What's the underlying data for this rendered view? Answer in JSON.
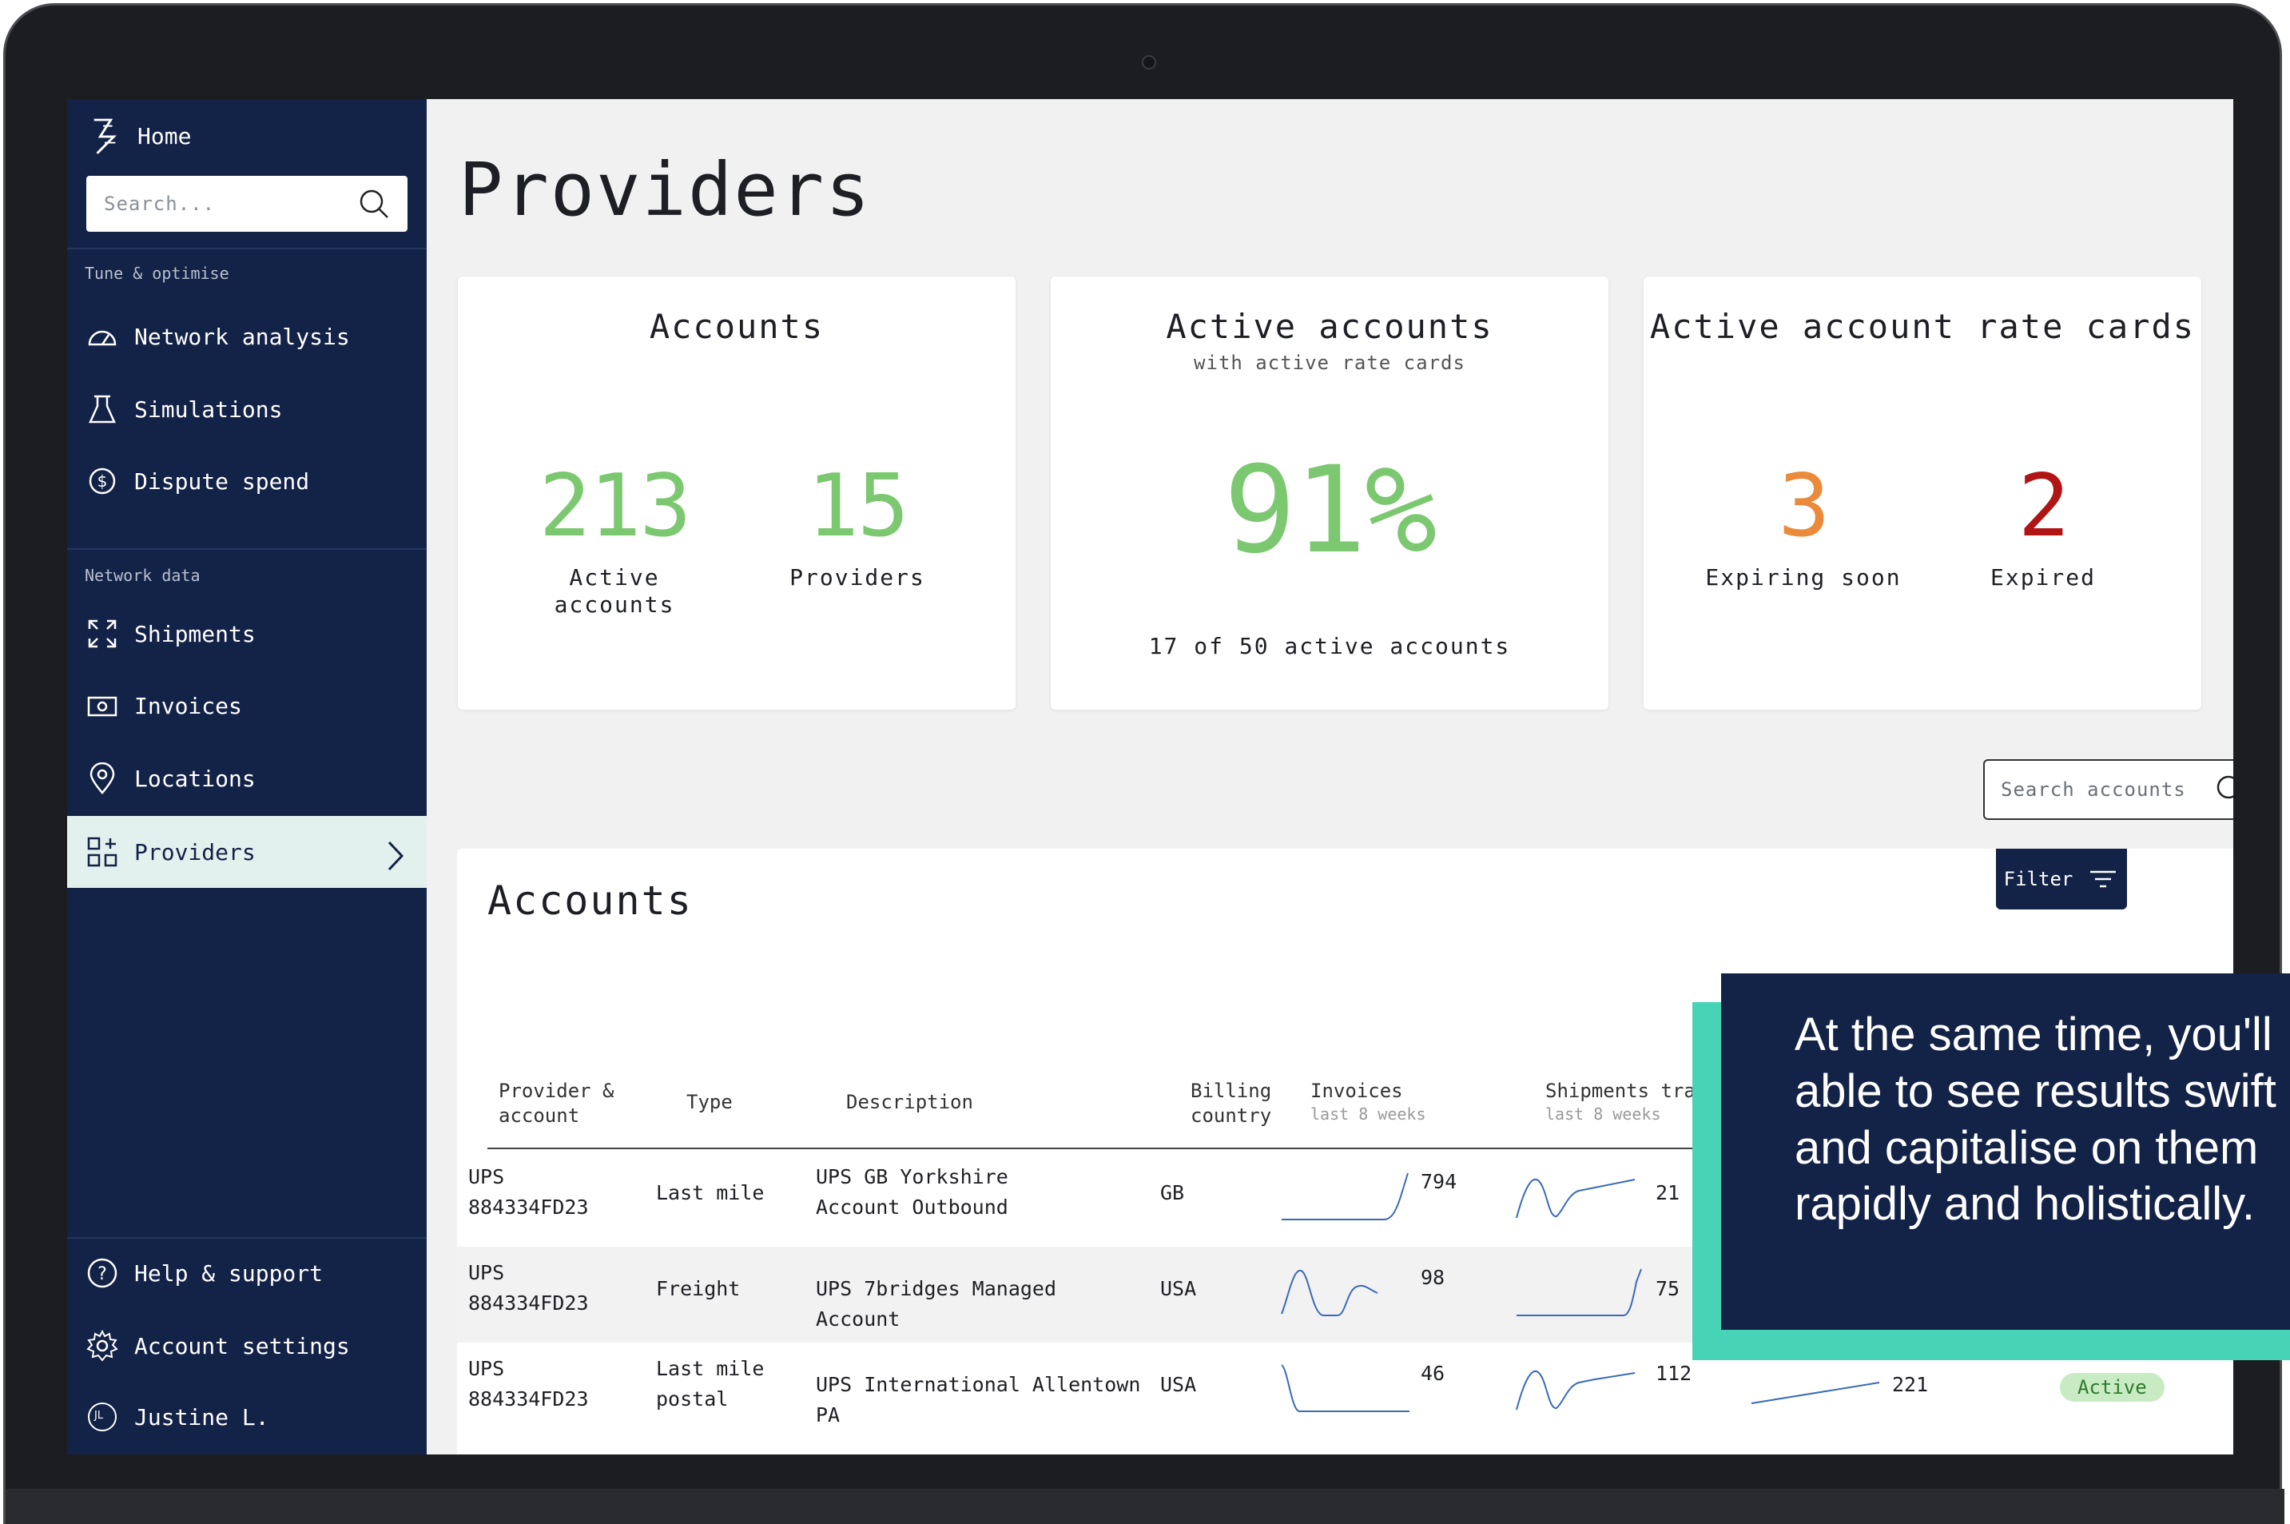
{
  "sidebar": {
    "home_label": "Home",
    "search_placeholder": "Search...",
    "section_tune": "Tune & optimise",
    "section_network": "Network data",
    "items": [
      {
        "label": "Network analysis",
        "icon": "gauge-icon"
      },
      {
        "label": "Simulations",
        "icon": "flask-icon"
      },
      {
        "label": "Dispute spend",
        "icon": "dollar-badge-icon"
      },
      {
        "label": "Shipments",
        "icon": "expand-arrows-icon"
      },
      {
        "label": "Invoices",
        "icon": "banknote-icon"
      },
      {
        "label": "Locations",
        "icon": "map-pin-icon"
      },
      {
        "label": "Providers",
        "icon": "grid-plus-icon",
        "active": true
      }
    ],
    "footer": {
      "help": "Help & support",
      "settings": "Account settings",
      "user": "Justine L.",
      "user_initials": "JL"
    }
  },
  "page": {
    "title": "Providers"
  },
  "cards": {
    "accounts": {
      "title": "Accounts",
      "active_value": "213",
      "active_label": "Active accounts",
      "providers_value": "15",
      "providers_label": "Providers"
    },
    "active_accounts": {
      "title": "Active accounts",
      "subtitle": "with active rate cards",
      "value": "91%",
      "footnote": "17 of 50 active accounts"
    },
    "rate_cards": {
      "title": "Active account rate cards",
      "expiring_value": "3",
      "expiring_label": "Expiring soon",
      "expired_value": "2",
      "expired_label": "Expired"
    }
  },
  "accounts_table": {
    "search_placeholder": "Search accounts",
    "title": "Accounts",
    "filter_label": "Filter",
    "headers": {
      "provider": "Provider & account",
      "type": "Type",
      "description": "Description",
      "billing": "Billing country",
      "invoices": "Invoices",
      "invoices_sub": "last 8 weeks",
      "shipments": "Shipments trac",
      "shipments_sub": "last 8 weeks"
    },
    "rows": [
      {
        "provider": "UPS",
        "account": "884334FD23",
        "type": "Last mile",
        "description": "UPS GB Yorkshire Account Outbound",
        "billing": "GB",
        "invoices": "794",
        "shipments": "21",
        "extra": "",
        "status": ""
      },
      {
        "provider": "UPS",
        "account": "884334FD23",
        "type": "Freight",
        "description": "UPS 7bridges Managed Account",
        "billing": "USA",
        "invoices": "98",
        "shipments": "75",
        "extra": "",
        "status": ""
      },
      {
        "provider": "UPS",
        "account": "884334FD23",
        "type": "Last mile postal",
        "description": "UPS International Allentown PA",
        "billing": "USA",
        "invoices": "46",
        "shipments": "112",
        "extra": "221",
        "status": "Active"
      }
    ]
  },
  "overlay": {
    "line1": "At the same time, you'll",
    "line2": "able to see results swift",
    "line3": "and capitalise on them",
    "line4": "rapidly and holistically."
  },
  "colors": {
    "sidebar": "#132247",
    "accent_green": "#7cc870",
    "accent_orange": "#ea8a3a",
    "accent_red": "#b01515",
    "overlay_accent": "#46d3b6"
  }
}
